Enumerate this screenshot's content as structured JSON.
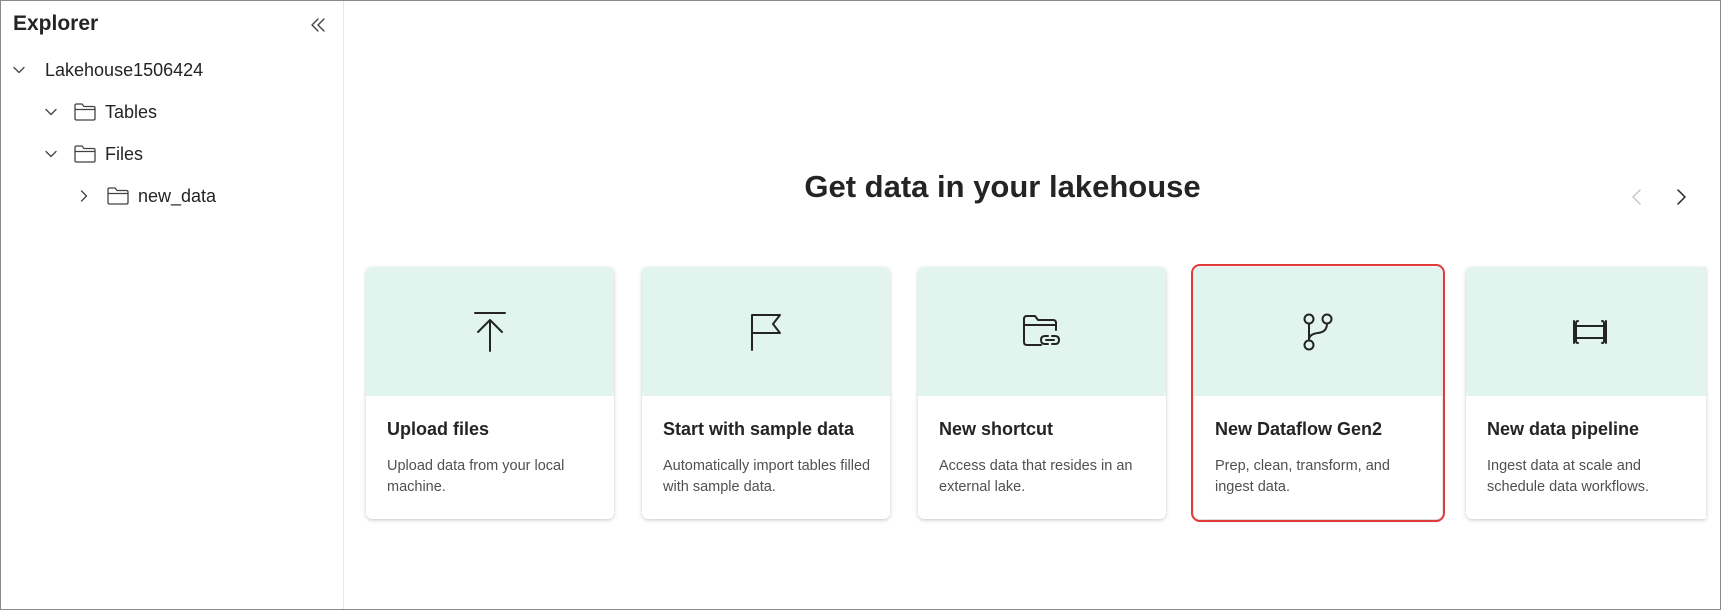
{
  "sidebar": {
    "title": "Explorer",
    "tree": [
      {
        "label": "Lakehouse1506424",
        "level": 0,
        "expanded": true
      },
      {
        "label": "Tables",
        "level": 1,
        "expanded": true
      },
      {
        "label": "Files",
        "level": 1,
        "expanded": true
      },
      {
        "label": "new_data",
        "level": 2,
        "expanded": false
      }
    ]
  },
  "main": {
    "heading": "Get data in your lakehouse",
    "cards": [
      {
        "title": "Upload files",
        "description": "Upload data from your local machine.",
        "icon": "upload-icon"
      },
      {
        "title": "Start with sample data",
        "description": "Automatically import tables filled with sample data.",
        "icon": "flag-icon"
      },
      {
        "title": "New shortcut",
        "description": "Access data that resides in an external lake.",
        "icon": "folder-link-icon"
      },
      {
        "title": "New Dataflow Gen2",
        "description": "Prep, clean, transform, and ingest data.",
        "icon": "branch-icon",
        "highlighted": true
      },
      {
        "title": "New data pipeline",
        "description": "Ingest data at scale and schedule data workflows.",
        "icon": "pipeline-icon"
      }
    ]
  },
  "colors": {
    "card_header_bg": "#e1f5ee",
    "highlight_border": "#e03a3a"
  }
}
